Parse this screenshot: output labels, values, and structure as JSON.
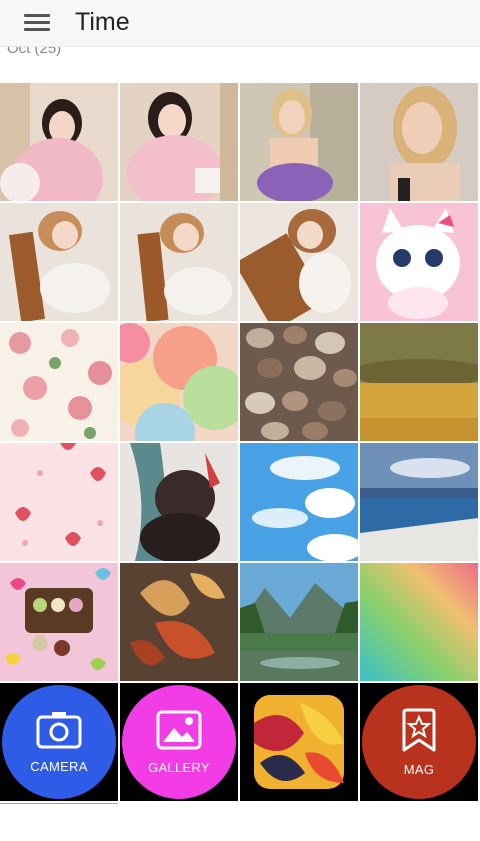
{
  "appbar": {
    "title": "Time"
  },
  "section": {
    "label": "Oct (25)"
  },
  "actions": [
    {
      "label": "CAMERA",
      "color": "#2f5ce6",
      "icon": "camera-icon"
    },
    {
      "label": "GALLERY",
      "color": "#f23ce6",
      "icon": "image-icon"
    },
    {
      "label": "MAG",
      "color": "#b8321e",
      "icon": "bookmark-star-icon"
    }
  ],
  "photos": [
    "girl-pink-sweater-1",
    "girl-pink-sweater-2",
    "blonde-purple-top",
    "blonde-portrait",
    "cello-girl-1",
    "cello-girl-2",
    "cello-girl-3",
    "pink-cat-cartoon",
    "floral-pattern",
    "pastel-balloons",
    "pebbles",
    "wheat-field",
    "strawberry-pattern",
    "anime-girl",
    "blue-sky-clouds",
    "seaside-cliff",
    "macarons-hearts",
    "autumn-leaves",
    "mountain-lake",
    "rainbow-gradient",
    "colorful-leaves-icon",
    "cherry-blossom"
  ]
}
